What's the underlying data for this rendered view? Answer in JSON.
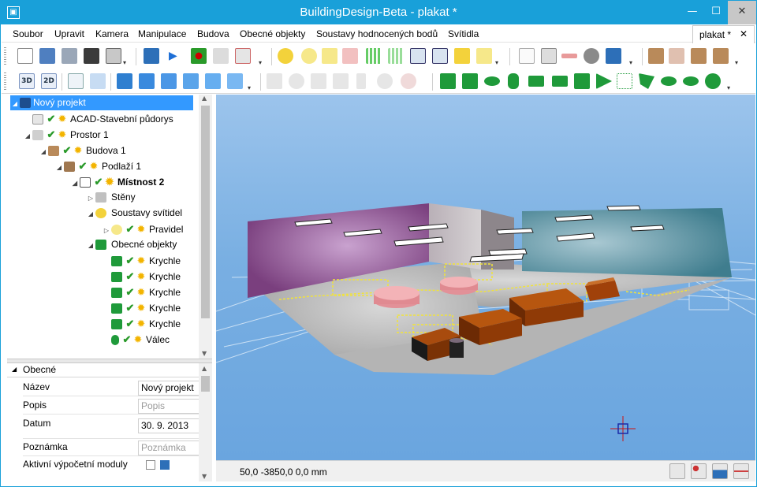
{
  "window": {
    "title": "BuildingDesign-Beta - plakat *",
    "minimize": "—",
    "maximize": "☐",
    "close": "✕"
  },
  "menu": [
    "Soubor",
    "Upravit",
    "Kamera",
    "Manipulace",
    "Budova",
    "Obecné objekty",
    "Soustavy hodnocených bodů",
    "Svítidla"
  ],
  "doc_tab": {
    "label": "plakat *",
    "close": "✕"
  },
  "toolbar_buttons": {
    "view_3d": "3D",
    "view_2d": "2D"
  },
  "tree": {
    "items": [
      {
        "label": "Nový projekt",
        "icon": "project-icon",
        "selected": true
      },
      {
        "label": "ACAD-Stavební půdorys",
        "icon": "dxf-file-icon"
      },
      {
        "label": "Prostor 1",
        "icon": "space-icon"
      },
      {
        "label": "Budova 1",
        "icon": "building-icon"
      },
      {
        "label": "Podlaží 1",
        "icon": "floor-icon"
      },
      {
        "label": "Místnost 2",
        "icon": "room-icon"
      },
      {
        "label": "Stěny",
        "icon": "walls-icon"
      },
      {
        "label": "Soustavy svítidel",
        "icon": "luminaire-systems-icon"
      },
      {
        "label": "Pravidel",
        "icon": "luminaire-icon"
      },
      {
        "label": "Obecné objekty",
        "icon": "general-objects-icon"
      },
      {
        "label": "Krychle",
        "icon": "cube-icon"
      },
      {
        "label": "Krychle",
        "icon": "cube-icon"
      },
      {
        "label": "Krychle",
        "icon": "cube-icon"
      },
      {
        "label": "Krychle",
        "icon": "cube-icon"
      },
      {
        "label": "Krychle",
        "icon": "cube-icon"
      },
      {
        "label": "Válec",
        "icon": "cylinder-icon"
      }
    ]
  },
  "properties": {
    "section": "Obecné",
    "rows": [
      {
        "key": "Název",
        "value": "Nový projekt",
        "placeholder": ""
      },
      {
        "key": "Popis",
        "value": "",
        "placeholder": "Popis"
      },
      {
        "key": "Datum",
        "value": "30. 9. 2013",
        "placeholder": ""
      },
      {
        "key": "Poznámka",
        "value": "",
        "placeholder": "Poznámka"
      },
      {
        "key": "Aktivní výpočetní moduly",
        "value": "",
        "placeholder": ""
      }
    ]
  },
  "status": {
    "coords": "50,0   -3850,0   0,0   mm"
  },
  "colors": {
    "titlebar": "#19a0d9",
    "selection": "#3399ff",
    "viewport_bg": "#76aee0"
  }
}
